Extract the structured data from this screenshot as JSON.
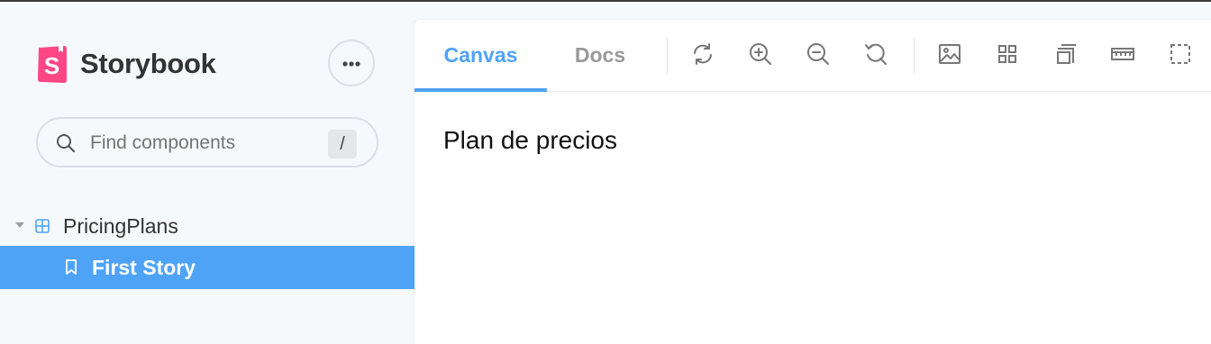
{
  "app": {
    "name": "Storybook",
    "accent": "#4fa3f7",
    "logo_color": "#ff4785"
  },
  "sidebar": {
    "menu_button_icon": "ellipsis-icon",
    "search": {
      "placeholder": "Find components",
      "value": "",
      "shortcut": "/"
    },
    "tree": {
      "group": {
        "label": "PricingPlans",
        "icon": "component-icon",
        "expanded": true
      },
      "items": [
        {
          "label": "First Story",
          "icon": "bookmark-icon",
          "selected": true
        }
      ]
    }
  },
  "toolbar": {
    "tabs": [
      {
        "label": "Canvas",
        "active": true
      },
      {
        "label": "Docs",
        "active": false
      }
    ],
    "tools": [
      "refresh-icon",
      "zoom-in-icon",
      "zoom-out-icon",
      "zoom-reset-icon",
      "background-icon",
      "grid-icon",
      "viewport-icon",
      "measure-icon",
      "outline-icon"
    ]
  },
  "preview": {
    "text": "Plan de precios"
  }
}
